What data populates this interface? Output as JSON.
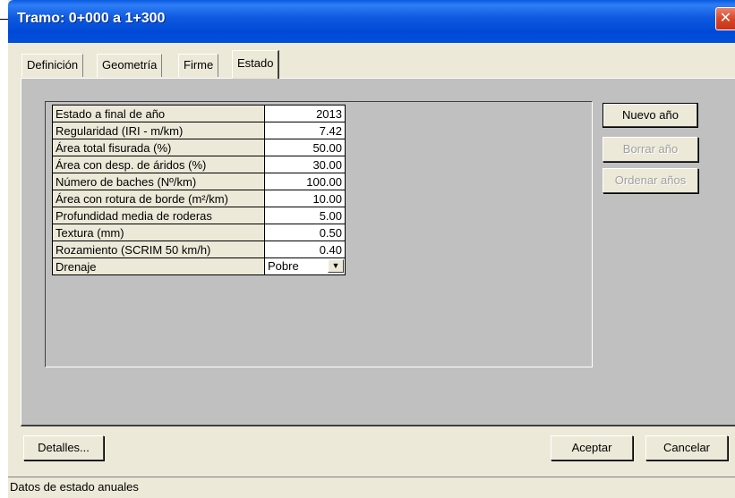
{
  "window": {
    "title": "Tramo: 0+000 a 1+300",
    "close_glyph": "✕"
  },
  "tabs": [
    {
      "label": "Definición"
    },
    {
      "label": "Geometría"
    },
    {
      "label": "Firme"
    },
    {
      "label": "Estado"
    }
  ],
  "active_tab": "Estado",
  "grid": {
    "rows": [
      {
        "label": "Estado a final de año",
        "value": "2013"
      },
      {
        "label": "Regularidad (IRI - m/km)",
        "value": "7.42"
      },
      {
        "label": "Área total fisurada (%)",
        "value": "50.00"
      },
      {
        "label": "Área con desp. de áridos (%)",
        "value": "30.00"
      },
      {
        "label": "Número de baches (Nº/km)",
        "value": "100.00"
      },
      {
        "label": "Área con rotura de borde (m²/km)",
        "value": "10.00"
      },
      {
        "label": "Profundidad media de roderas",
        "value": "5.00"
      },
      {
        "label": "Textura (mm)",
        "value": "0.50"
      },
      {
        "label": "Rozamiento (SCRIM 50 km/h)",
        "value": "0.40"
      }
    ],
    "drenaje": {
      "label": "Drenaje",
      "selected": "Pobre",
      "arrow_glyph": "▼"
    }
  },
  "side_buttons": {
    "nuevo": "Nuevo año",
    "borrar": "Borrar año",
    "ordenar": "Ordenar años"
  },
  "footer_buttons": {
    "detalles": "Detalles...",
    "aceptar": "Aceptar",
    "cancelar": "Cancelar"
  },
  "status": {
    "text": "Datos de estado anuales"
  }
}
